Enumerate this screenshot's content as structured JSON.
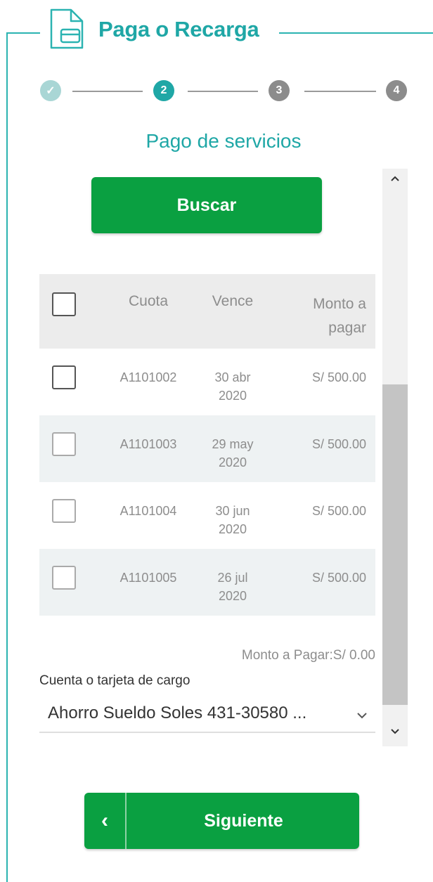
{
  "header": {
    "title": "Paga o Recarga",
    "icon": "document-card-icon"
  },
  "stepper": {
    "steps": [
      {
        "label": "✓",
        "state": "done"
      },
      {
        "label": "2",
        "state": "active"
      },
      {
        "label": "3",
        "state": "pending"
      },
      {
        "label": "4",
        "state": "pending"
      }
    ]
  },
  "section_title": "Pago de servicios",
  "search_button": "Buscar",
  "table": {
    "headers": {
      "cuota": "Cuota",
      "vence": "Vence",
      "monto_line1": "Monto a",
      "monto_line2": "pagar"
    },
    "rows": [
      {
        "cuota": "A1101002",
        "vence_line1": "30 abr",
        "vence_line2": "2020",
        "monto": "S/ 500.00"
      },
      {
        "cuota": "A1101003",
        "vence_line1": "29 may",
        "vence_line2": "2020",
        "monto": "S/ 500.00"
      },
      {
        "cuota": "A1101004",
        "vence_line1": "30 jun",
        "vence_line2": "2020",
        "monto": "S/ 500.00"
      },
      {
        "cuota": "A1101005",
        "vence_line1": "26 jul",
        "vence_line2": "2020",
        "monto": "S/ 500.00"
      }
    ]
  },
  "total": "Monto a Pagar:S/ 0.00",
  "account": {
    "label": "Cuenta o tarjeta de cargo",
    "value": "Ahorro Sueldo Soles  431-30580 ..."
  },
  "next_button": {
    "back_label": "‹",
    "label": "Siguiente"
  },
  "colors": {
    "brand_teal": "#1fa7a6",
    "brand_green": "#0aa041",
    "step_pending": "#8c8c8c"
  }
}
